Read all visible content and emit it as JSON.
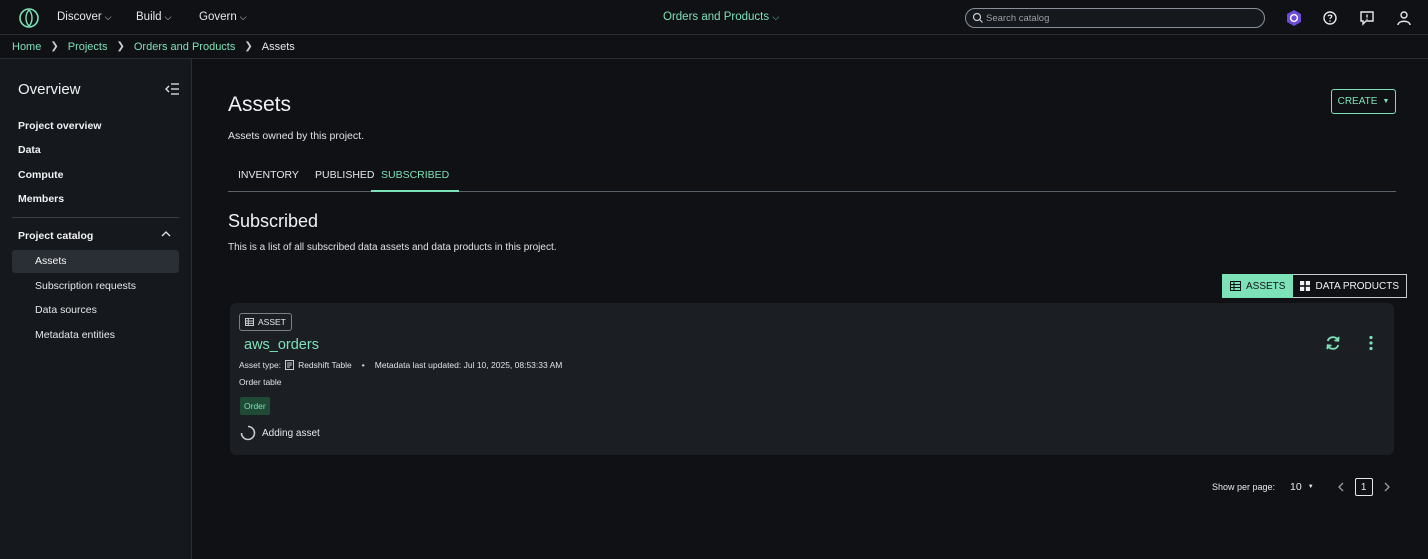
{
  "topbar": {
    "nav": [
      {
        "label": "Discover"
      },
      {
        "label": "Build"
      },
      {
        "label": "Govern"
      }
    ],
    "project_switcher": "Orders and Products",
    "search_placeholder": "Search catalog"
  },
  "breadcrumb": {
    "items": [
      "Home",
      "Projects",
      "Orders and Products"
    ],
    "current": "Assets"
  },
  "sidebar": {
    "title": "Overview",
    "items": [
      "Project overview",
      "Data",
      "Compute",
      "Members"
    ],
    "catalog_title": "Project catalog",
    "catalog_items": [
      "Assets",
      "Subscription requests",
      "Data sources",
      "Metadata entities"
    ]
  },
  "main": {
    "title": "Assets",
    "description": "Assets owned by this project.",
    "create_label": "CREATE",
    "tabs": [
      "INVENTORY",
      "PUBLISHED",
      "SUBSCRIBED"
    ],
    "section_title": "Subscribed",
    "section_desc": "This is a list of all subscribed data assets and data products in this project.",
    "toggle": [
      "ASSETS",
      "DATA PRODUCTS"
    ]
  },
  "card": {
    "badge": "ASSET",
    "name": "aws_orders",
    "asset_type_label": "Asset type:",
    "asset_type": "Redshift Table",
    "bullet": "•",
    "metadata_updated": "Metadata last updated: Jul 10, 2025, 08:53:33 AM",
    "description": "Order table",
    "tag": "Order",
    "status": "Adding asset"
  },
  "pager": {
    "per_page_label": "Show per page:",
    "per_page": "10",
    "page": "1"
  },
  "colors": {
    "accent": "#7ee2b8",
    "background": "#0f1114",
    "card": "#1b1f24"
  }
}
